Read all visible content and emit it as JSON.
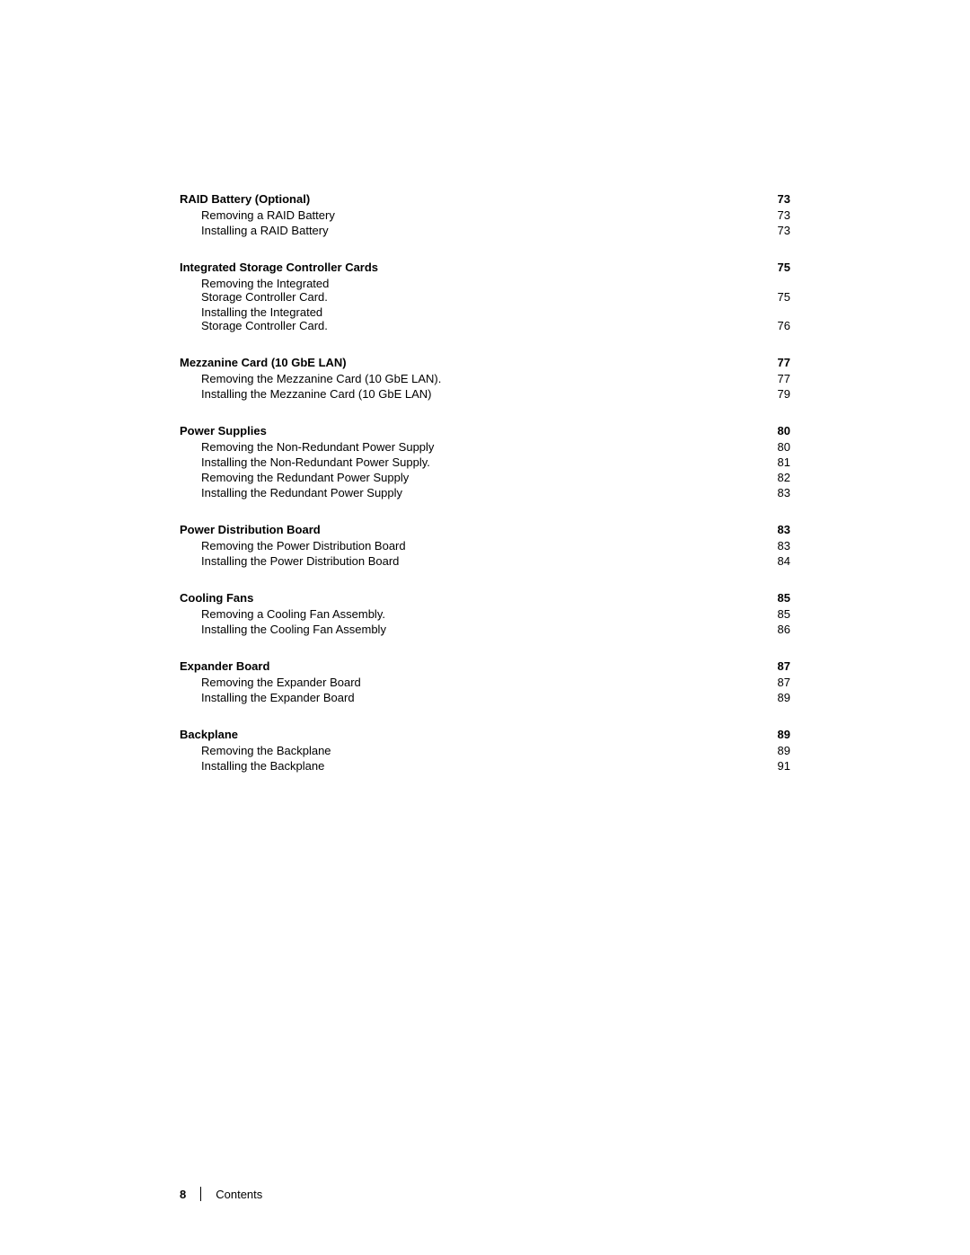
{
  "toc": {
    "sections": [
      {
        "id": "raid-battery",
        "title": "RAID Battery (Optional)",
        "bold": true,
        "page": "73",
        "dots": true,
        "sub_items": [
          {
            "id": "removing-raid-battery",
            "text": "Removing a RAID Battery",
            "page": "73",
            "dots": true,
            "multiline": false
          },
          {
            "id": "installing-raid-battery",
            "text": "Installing a RAID Battery",
            "page": "73",
            "dots": true,
            "multiline": false
          }
        ]
      },
      {
        "id": "integrated-storage",
        "title": "Integrated Storage Controller Cards",
        "bold": true,
        "page": "75",
        "dots": true,
        "sub_items": [
          {
            "id": "removing-integrated-storage",
            "text": "Removing the Integrated\nStorage Controller Card.",
            "page": "75",
            "dots": true,
            "multiline": true
          },
          {
            "id": "installing-integrated-storage",
            "text": "Installing the Integrated\nStorage Controller Card.",
            "page": "76",
            "dots": true,
            "multiline": true
          }
        ]
      },
      {
        "id": "mezzanine-card",
        "title": "Mezzanine Card (10 GbE LAN)",
        "bold": true,
        "page": "77",
        "dots": true,
        "sub_items": [
          {
            "id": "removing-mezzanine",
            "text": "Removing the Mezzanine Card (10 GbE LAN).",
            "page": "77",
            "dots": false,
            "multiline": false
          },
          {
            "id": "installing-mezzanine",
            "text": "Installing the Mezzanine Card (10 GbE LAN)",
            "page": "79",
            "dots": false,
            "multiline": false
          }
        ]
      },
      {
        "id": "power-supplies",
        "title": "Power Supplies",
        "bold": true,
        "page": "80",
        "dots": true,
        "sub_items": [
          {
            "id": "removing-non-redundant",
            "text": "Removing the Non-Redundant Power Supply",
            "page": "80",
            "dots": false,
            "multiline": false
          },
          {
            "id": "installing-non-redundant",
            "text": "Installing the Non-Redundant Power Supply.",
            "page": "81",
            "dots": false,
            "multiline": false
          },
          {
            "id": "removing-redundant",
            "text": "Removing the Redundant Power Supply",
            "page": "82",
            "dots": false,
            "multiline": false
          },
          {
            "id": "installing-redundant",
            "text": "Installing the Redundant Power Supply",
            "page": "83",
            "dots": false,
            "multiline": false
          }
        ]
      },
      {
        "id": "power-distribution",
        "title": "Power Distribution Board",
        "bold": true,
        "page": "83",
        "dots": true,
        "sub_items": [
          {
            "id": "removing-pdb",
            "text": "Removing the Power Distribution Board",
            "page": "83",
            "dots": false,
            "multiline": false
          },
          {
            "id": "installing-pdb",
            "text": "Installing the Power Distribution Board",
            "page": "84",
            "dots": false,
            "multiline": false
          }
        ]
      },
      {
        "id": "cooling-fans",
        "title": "Cooling Fans",
        "bold": true,
        "page": "85",
        "dots": true,
        "sub_items": [
          {
            "id": "removing-cooling-fan",
            "text": "Removing a Cooling Fan Assembly.",
            "page": "85",
            "dots": false,
            "multiline": false
          },
          {
            "id": "installing-cooling-fan",
            "text": "Installing the Cooling Fan Assembly",
            "page": "86",
            "dots": false,
            "multiline": false
          }
        ]
      },
      {
        "id": "expander-board",
        "title": "Expander Board",
        "bold": true,
        "page": "87",
        "dots": true,
        "sub_items": [
          {
            "id": "removing-expander",
            "text": "Removing the Expander Board",
            "page": "87",
            "dots": false,
            "multiline": false
          },
          {
            "id": "installing-expander",
            "text": "Installing the Expander Board",
            "page": "89",
            "dots": false,
            "multiline": false
          }
        ]
      },
      {
        "id": "backplane",
        "title": "Backplane",
        "bold": true,
        "page": "89",
        "dots": true,
        "sub_items": [
          {
            "id": "removing-backplane",
            "text": "Removing the Backplane",
            "page": "89",
            "dots": false,
            "multiline": false
          },
          {
            "id": "installing-backplane",
            "text": "Installing the Backplane",
            "page": "91",
            "dots": false,
            "multiline": false
          }
        ]
      }
    ]
  },
  "footer": {
    "page_number": "8",
    "divider": "|",
    "section_label": "Contents"
  }
}
